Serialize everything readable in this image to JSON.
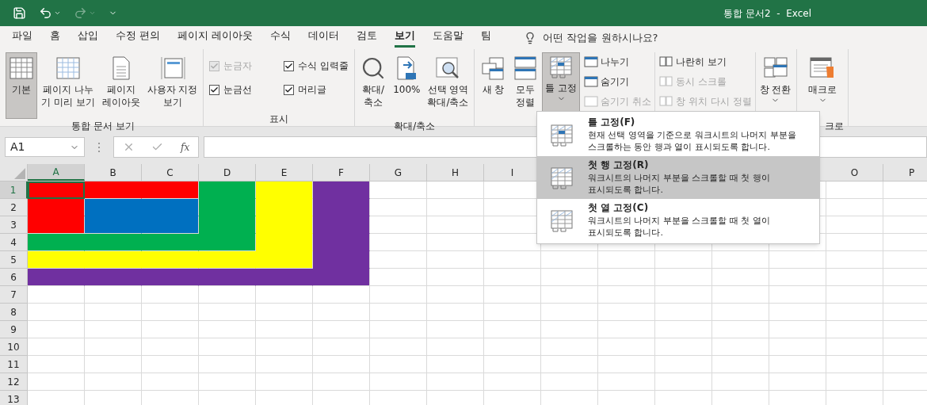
{
  "title_bar": {
    "title": "통합 문서2  -  Excel"
  },
  "quick_access": [
    {
      "disabled": false
    },
    {
      "disabled": false
    },
    {
      "disabled": true
    },
    {
      "disabled": false
    }
  ],
  "menu_tabs": [
    {
      "label": "파일",
      "selected": false
    },
    {
      "label": "홈",
      "selected": false
    },
    {
      "label": "삽입",
      "selected": false
    },
    {
      "label": "수정 편의",
      "selected": false
    },
    {
      "label": "페이지 레이아웃",
      "selected": false
    },
    {
      "label": "수식",
      "selected": false
    },
    {
      "label": "데이터",
      "selected": false
    },
    {
      "label": "검토",
      "selected": false
    },
    {
      "label": "보기",
      "selected": true
    },
    {
      "label": "도움말",
      "selected": false
    },
    {
      "label": "팀",
      "selected": false
    }
  ],
  "tell_me": {
    "placeholder": "어떤 작업을 원하시나요?"
  },
  "ribbon": {
    "groups": [
      {
        "label": "통합 문서 보기",
        "items": [
          {
            "kind": "large",
            "label": "기본",
            "selected": true,
            "dropdown": false
          },
          {
            "kind": "large",
            "label": "페이지 나누\n기 미리 보기",
            "selected": false,
            "dropdown": false
          },
          {
            "kind": "large",
            "label": "페이지\n레이아웃",
            "selected": false,
            "dropdown": false
          },
          {
            "kind": "large",
            "label": "사용자 지정\n보기",
            "selected": false,
            "dropdown": false
          }
        ]
      },
      {
        "label": "표시",
        "items": [
          {
            "kind": "checkboxes",
            "checkboxes": [
              {
                "label": "눈금자",
                "checked": true,
                "disabled": true
              },
              {
                "label": "수식 입력줄",
                "checked": true,
                "disabled": false
              },
              {
                "label": "눈금선",
                "checked": true,
                "disabled": false
              },
              {
                "label": "머리글",
                "checked": true,
                "disabled": false
              }
            ]
          }
        ]
      },
      {
        "label": "확대/축소",
        "items": [
          {
            "kind": "large",
            "label": "확대/\n축소",
            "selected": false,
            "dropdown": false
          },
          {
            "kind": "large",
            "label": "100%",
            "selected": false,
            "dropdown": false
          },
          {
            "kind": "large",
            "label": "선택 영역\n확대/축소",
            "selected": false,
            "dropdown": false
          }
        ]
      },
      {
        "items": [
          {
            "kind": "large",
            "label": "새 창",
            "selected": false,
            "dropdown": false
          },
          {
            "kind": "large",
            "label": "모두\n정렬",
            "selected": false,
            "dropdown": false
          },
          {
            "kind": "large",
            "label": "틀 고정",
            "selected": true,
            "dropdown": true
          },
          {
            "kind": "column",
            "commands": [
              {
                "label": "나누기",
                "disabled": false
              },
              {
                "label": "숨기기",
                "disabled": false
              },
              {
                "label": "숨기기 취소",
                "disabled": true
              }
            ]
          },
          {
            "kind": "column",
            "commands": [
              {
                "label": "나란히 보기",
                "disabled": false
              },
              {
                "label": "동시 스크롤",
                "disabled": true
              },
              {
                "label": "창 위치 다시 정렬",
                "disabled": true
              }
            ]
          },
          {
            "kind": "large",
            "label": "창 전환",
            "selected": false,
            "dropdown": true
          }
        ]
      },
      {
        "label": "크로",
        "items": [
          {
            "kind": "large",
            "label": "매크로",
            "selected": false,
            "dropdown": true
          }
        ]
      }
    ]
  },
  "formula_bar": {
    "name_box": "A1",
    "function_label": "fx"
  },
  "sheet": {
    "columns": [
      {
        "label": "A",
        "selected": true
      },
      {
        "label": "B",
        "selected": false
      },
      {
        "label": "C",
        "selected": false
      },
      {
        "label": "D",
        "selected": false
      },
      {
        "label": "E",
        "selected": false
      },
      {
        "label": "F",
        "selected": false
      },
      {
        "label": "G",
        "selected": false
      },
      {
        "label": "H",
        "selected": false
      },
      {
        "label": "I",
        "selected": false
      },
      {
        "label": "O",
        "selected": false
      },
      {
        "label": "P",
        "selected": false
      }
    ],
    "rows": [
      {
        "header": "1",
        "selected": true,
        "cells": [
          {
            "color": "#ff0000",
            "selected": true
          },
          {
            "color": "#ff0000",
            "selected": false
          },
          {
            "color": "#ff0000",
            "selected": false
          },
          {
            "color": "#00b050",
            "selected": false
          },
          {
            "color": "#ffff00",
            "selected": false
          },
          {
            "color": "#7030a0",
            "selected": false
          }
        ]
      },
      {
        "header": "2",
        "selected": false,
        "cells": [
          {
            "color": "#ff0000",
            "selected": false
          },
          {
            "color": "#0070c0",
            "selected": false
          },
          {
            "color": "#0070c0",
            "selected": false
          },
          {
            "color": "#00b050",
            "selected": false
          },
          {
            "color": "#ffff00",
            "selected": false
          },
          {
            "color": "#7030a0",
            "selected": false
          }
        ]
      },
      {
        "header": "3",
        "selected": false,
        "cells": [
          {
            "color": "#ff0000",
            "selected": false
          },
          {
            "color": "#0070c0",
            "selected": false
          },
          {
            "color": "#0070c0",
            "selected": false
          },
          {
            "color": "#00b050",
            "selected": false
          },
          {
            "color": "#ffff00",
            "selected": false
          },
          {
            "color": "#7030a0",
            "selected": false
          }
        ]
      },
      {
        "header": "4",
        "selected": false,
        "cells": [
          {
            "color": "#00b050",
            "selected": false
          },
          {
            "color": "#00b050",
            "selected": false
          },
          {
            "color": "#00b050",
            "selected": false
          },
          {
            "color": "#00b050",
            "selected": false
          },
          {
            "color": "#ffff00",
            "selected": false
          },
          {
            "color": "#7030a0",
            "selected": false
          }
        ]
      },
      {
        "header": "5",
        "selected": false,
        "cells": [
          {
            "color": "#ffff00",
            "selected": false
          },
          {
            "color": "#ffff00",
            "selected": false
          },
          {
            "color": "#ffff00",
            "selected": false
          },
          {
            "color": "#ffff00",
            "selected": false
          },
          {
            "color": "#ffff00",
            "selected": false
          },
          {
            "color": "#7030a0",
            "selected": false
          }
        ]
      },
      {
        "header": "6",
        "selected": false,
        "cells": [
          {
            "color": "#7030a0",
            "selected": false
          },
          {
            "color": "#7030a0",
            "selected": false
          },
          {
            "color": "#7030a0",
            "selected": false
          },
          {
            "color": "#7030a0",
            "selected": false
          },
          {
            "color": "#7030a0",
            "selected": false
          },
          {
            "color": "#7030a0",
            "selected": false
          }
        ]
      },
      {
        "header": "7",
        "selected": false,
        "cells": []
      },
      {
        "header": "8",
        "selected": false,
        "cells": []
      },
      {
        "header": "9",
        "selected": false,
        "cells": []
      },
      {
        "header": "10",
        "selected": false,
        "cells": []
      },
      {
        "header": "11",
        "selected": false,
        "cells": []
      },
      {
        "header": "12",
        "selected": false,
        "cells": []
      },
      {
        "header": "13",
        "selected": false,
        "cells": []
      }
    ]
  },
  "freeze_menu": {
    "items": [
      {
        "title": "틀 고정(F)",
        "description": "현재 선택 영역을 기준으로 워크시트의 나머지 부분을\n스크롤하는 동안 행과 열이 표시되도록 합니다.",
        "selected": false
      },
      {
        "title": "첫 행 고정(R)",
        "description": "워크시트의 나머지 부분을 스크롤할 때 첫 행이\n표시되도록 합니다.",
        "selected": true
      },
      {
        "title": "첫 열 고정(C)",
        "description": "워크시트의 나머지 부분을 스크롤할 때 첫 열이\n표시되도록 합니다.",
        "selected": false
      }
    ]
  }
}
